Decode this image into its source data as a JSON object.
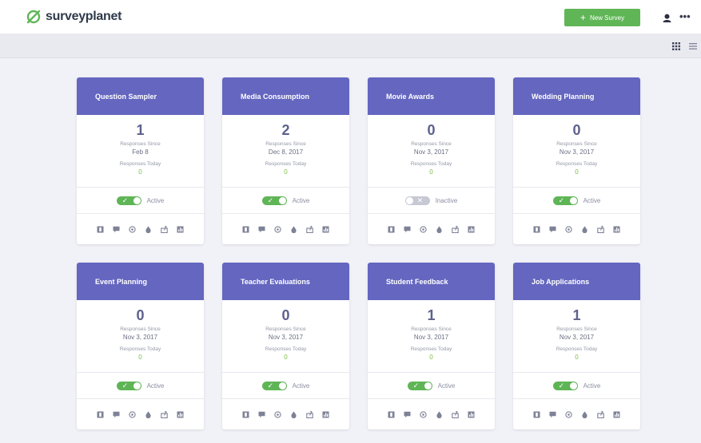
{
  "header": {
    "brand": "surveyplanet",
    "new_survey_label": "New Survey",
    "new_survey_icon": "plus-icon",
    "user_icon": "user-icon",
    "more_label": "•••"
  },
  "viewbar": {
    "icons": [
      "grid-view-icon",
      "list-view-icon"
    ]
  },
  "cards": [
    {
      "title": "Question Sampler",
      "count": "1",
      "since_label": "Responses Since",
      "since": "Feb 8",
      "today_label": "Responses Today",
      "today": "0",
      "status": "Active"
    },
    {
      "title": "Media Consumption",
      "count": "2",
      "since_label": "Responses Since",
      "since": "Dec 8, 2017",
      "today_label": "Responses Today",
      "today": "0",
      "status": "Active"
    },
    {
      "title": "Movie Awards",
      "count": "0",
      "since_label": "Responses Since",
      "since": "Nov 3, 2017",
      "today_label": "Responses Today",
      "today": "0",
      "status": "Inactive"
    },
    {
      "title": "Wedding Planning",
      "count": "0",
      "since_label": "Responses Since",
      "since": "Nov 3, 2017",
      "today_label": "Responses Today",
      "today": "0",
      "status": "Active"
    },
    {
      "title": "Event Planning",
      "count": "0",
      "since_label": "Responses Since",
      "since": "Nov 3, 2017",
      "today_label": "Responses Today",
      "today": "0",
      "status": "Active"
    },
    {
      "title": "Teacher Evaluations",
      "count": "0",
      "since_label": "Responses Since",
      "since": "Nov 3, 2017",
      "today_label": "Responses Today",
      "today": "0",
      "status": "Active"
    },
    {
      "title": "Student Feedback",
      "count": "1",
      "since_label": "Responses Since",
      "since": "Nov 3, 2017",
      "today_label": "Responses Today",
      "today": "0",
      "status": "Active"
    },
    {
      "title": "Job Applications",
      "count": "1",
      "since_label": "Responses Since",
      "since": "Nov 3, 2017",
      "today_label": "Responses Today",
      "today": "0",
      "status": "Active"
    }
  ],
  "card_action_icons": [
    "edit-icon",
    "comment-icon",
    "preview-icon",
    "theme-icon",
    "share-icon",
    "results-icon"
  ],
  "colors": {
    "brand_green": "#60b657",
    "card_header": "#6466c0",
    "today_green": "#7bbf44",
    "toggle_off": "#c6c8d4"
  }
}
